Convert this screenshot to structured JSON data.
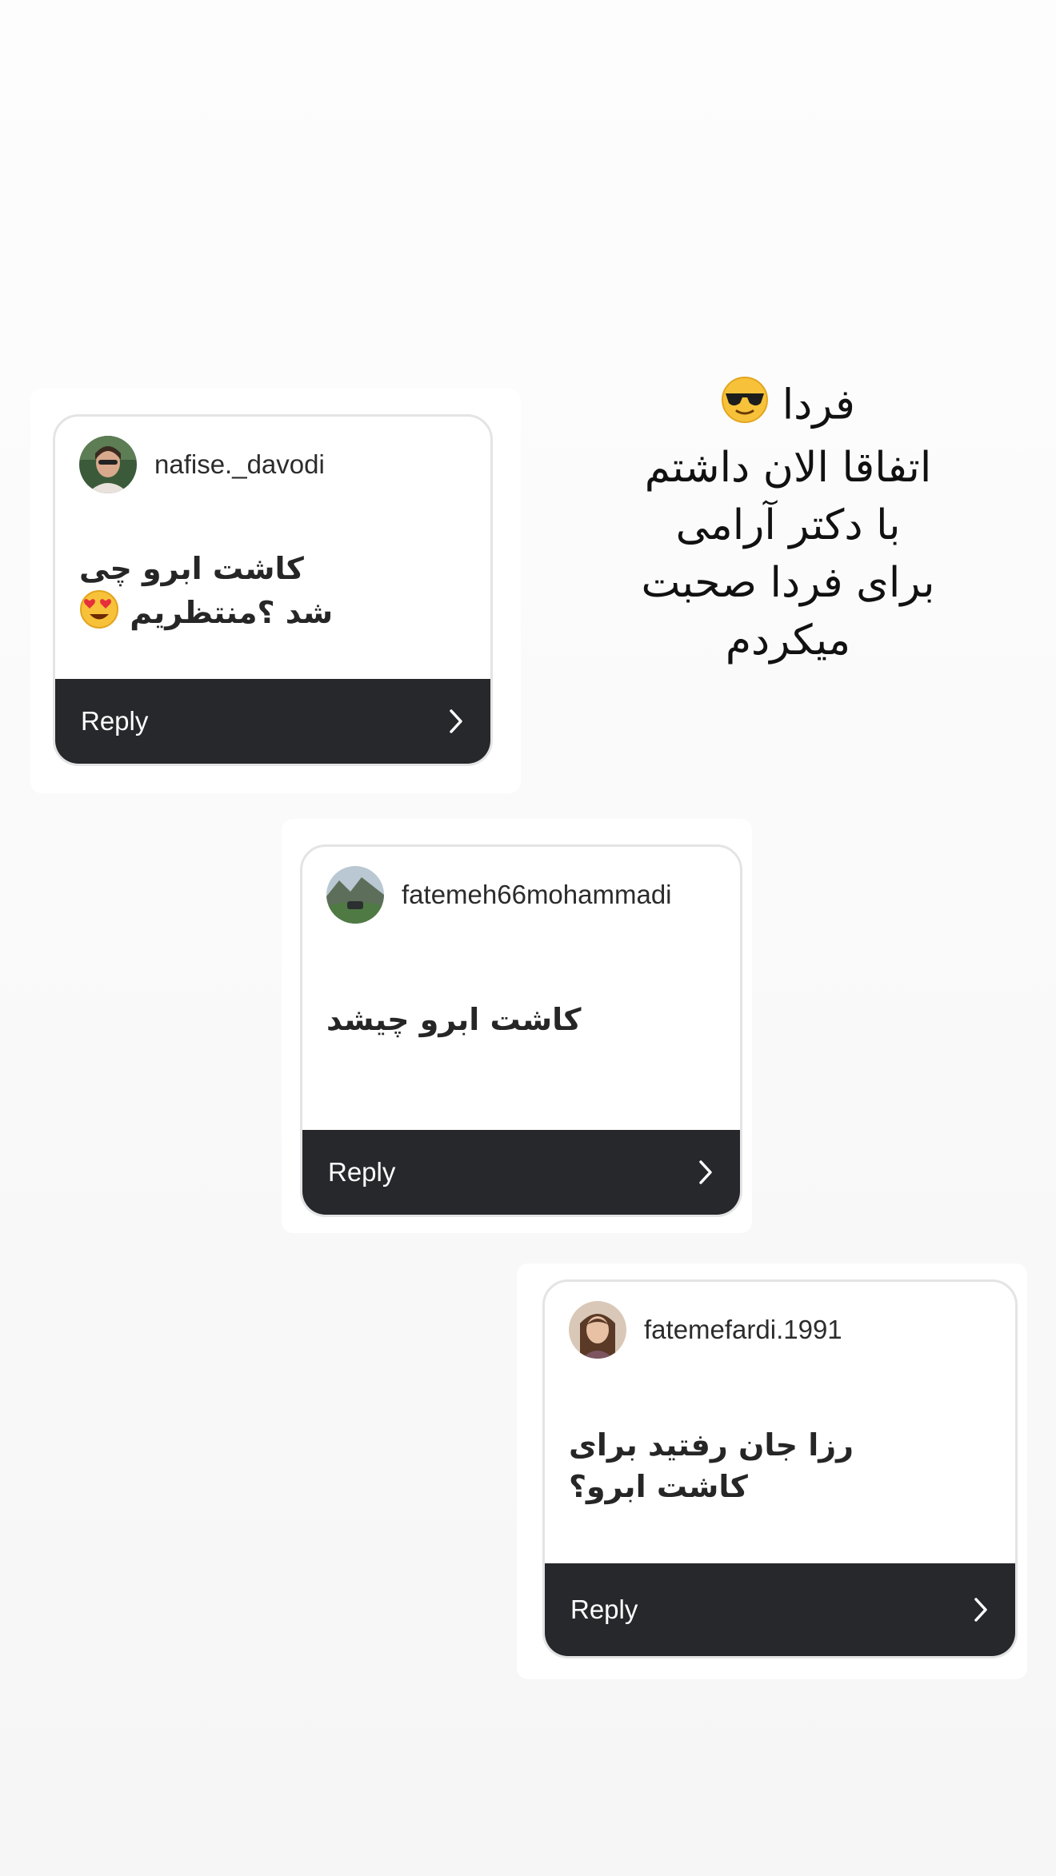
{
  "story_caption": {
    "lines": [
      "فردا",
      "اتفاقا الان داشتم",
      "با دکتر آرامی",
      "برای فردا صحبت",
      "میکردم"
    ],
    "emoji": "sunglasses-face-emoji"
  },
  "question_stickers": [
    {
      "username": "nafise._davodi",
      "question_lines": [
        "کاشت ابرو چی",
        "شد ؟منتظریم"
      ],
      "question_emoji": "heart-eyes-emoji",
      "reply_label": "Reply"
    },
    {
      "username": "fatemeh66mohammadi",
      "question_lines": [
        "کاشت ابرو چیشد"
      ],
      "reply_label": "Reply"
    },
    {
      "username": "fatemefardi.1991",
      "question_lines": [
        "رزا جان رفتید برای",
        "کاشت ابرو؟"
      ],
      "reply_label": "Reply"
    }
  ],
  "colors": {
    "reply_bar": "#26282c",
    "card_border": "#e4e4e4",
    "background": "#f8f8f8"
  }
}
